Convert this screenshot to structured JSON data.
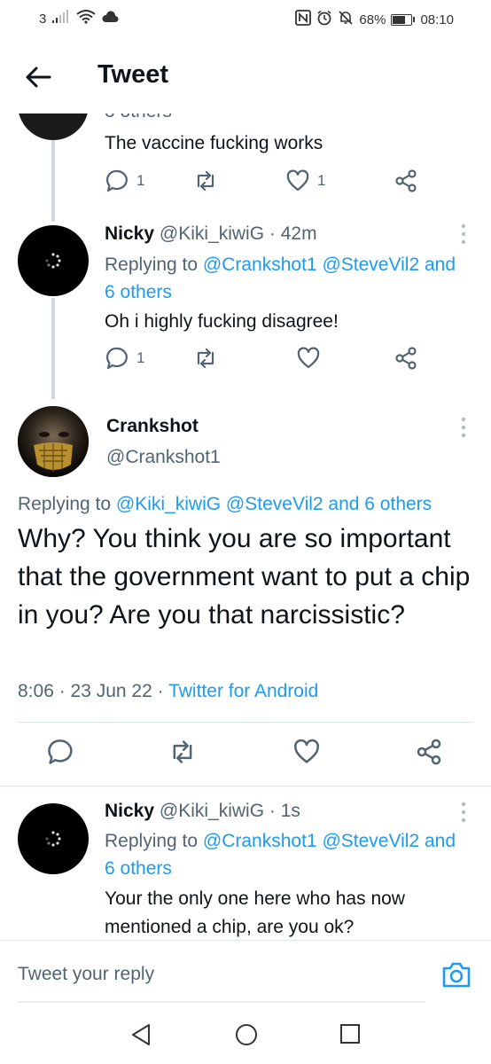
{
  "status_bar": {
    "sim_number": "3",
    "battery_percent": "68%",
    "battery_level": 0.68,
    "time": "08:10",
    "icons": [
      "signal-icon",
      "wifi-icon",
      "cloud-icon",
      "nfc-icon",
      "alarm-icon",
      "mute-icon",
      "battery-icon"
    ]
  },
  "header": {
    "title": "Tweet"
  },
  "thread": {
    "clipped": {
      "partial_text": "o others",
      "text": "The vaccine fucking works",
      "reply_count": "1",
      "like_count": "1"
    },
    "reply_1": {
      "name": "Nicky",
      "handle": "@Kiki_kiwiG",
      "separator": " · ",
      "time": "42m",
      "replying_label": "Replying to ",
      "mention_1": "@Crankshot1",
      "mention_2": "@SteveVil2",
      "mention_others": "and 6 others",
      "text": "Oh i highly fucking disagree!",
      "reply_count": "1"
    },
    "main": {
      "name": "Crankshot",
      "handle": "@Crankshot1",
      "replying_label": "Replying to ",
      "mention_1": "@Kiki_kiwiG",
      "mention_2": "@SteveVil2",
      "mention_others": "and 6 others",
      "text": "Why? You think you are so important that the government want to put a chip in you? Are you that narcissistic?",
      "time": "8:06",
      "date": "23 Jun 22",
      "dot": " · ",
      "source": "Twitter for Android"
    },
    "reply_2": {
      "name": "Nicky",
      "handle": "@Kiki_kiwiG",
      "separator": " · ",
      "time": "1s",
      "replying_label": "Replying to ",
      "mention_1": "@Crankshot1",
      "mention_2": "@SteveVil2",
      "mention_others": "and 6 others",
      "text": "Your the only one here who has now mentioned a chip, are you ok?"
    }
  },
  "reply_box": {
    "placeholder": "Tweet your reply"
  },
  "colors": {
    "accent": "#1d9bf0",
    "secondary_text": "#536471",
    "primary_text": "#0f1419"
  }
}
